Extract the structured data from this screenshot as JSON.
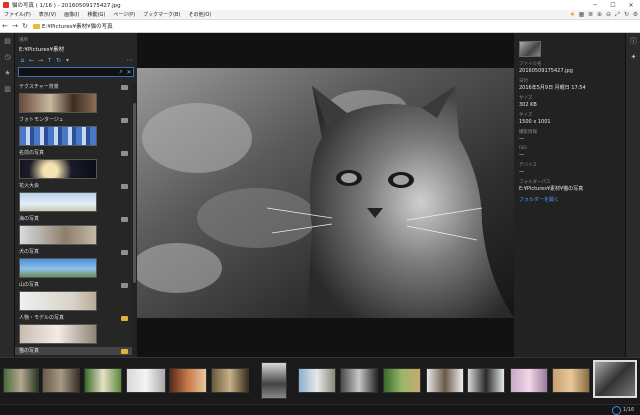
{
  "window": {
    "title": "猫の写真 ( 1/16 ) - 20160509175427.jpg",
    "minimize_icon": "minimize-icon",
    "maximize_icon": "maximize-icon",
    "close_icon": "close-icon"
  },
  "menu": {
    "items": [
      "ファイル(F)",
      "表示(V)",
      "画像(I)",
      "移動(G)",
      "ページ(P)",
      "ブックマーク(B)",
      "その他(O)"
    ],
    "right_icons": [
      "star-icon",
      "grid-icon",
      "list-icon",
      "zoom-in-icon",
      "zoom-out-icon",
      "fit-icon",
      "rotate-icon",
      "settings-icon"
    ]
  },
  "address": {
    "path": "E:¥Pictures¥素材¥猫の写真"
  },
  "sidebar": {
    "location_label": "場所",
    "location_path": "E:¥Pictures¥素材",
    "search_placeholder": "",
    "folders": [
      {
        "name": "テクスチャー背景",
        "icon": "gray"
      },
      {
        "name": "フォトモンタージュ",
        "icon": "gray"
      },
      {
        "name": "名前の写真",
        "icon": "gray"
      },
      {
        "name": "花火大会",
        "icon": "gray"
      },
      {
        "name": "海の写真",
        "icon": "gray"
      },
      {
        "name": "犬の写真",
        "icon": "gray"
      },
      {
        "name": "山の写真",
        "icon": "gray"
      },
      {
        "name": "人物・モデルの写真",
        "icon": "gold"
      },
      {
        "name": "猫の写真",
        "icon": "gold",
        "selected": true
      }
    ]
  },
  "info": {
    "filename_label": "ファイル名",
    "filename": "20160509175427.jpg",
    "date_label": "日付",
    "date": "2016年5月9日 月曜日 17:54",
    "size_label": "サイズ",
    "size": "302 KB",
    "dimensions_label": "サイズ",
    "dimensions": "1500 x 1001",
    "shooting_label": "撮影情報",
    "shooting": "—",
    "iso_label": "ISO",
    "iso": "—",
    "device_label": "デバイス",
    "device": "—",
    "folder_path_label": "フォルダーパス",
    "folder_path": "E:¥Pictures¥素材¥猫の写真",
    "open_folder_link": "フォルダーを開く"
  },
  "status": {
    "count": "1/16"
  }
}
